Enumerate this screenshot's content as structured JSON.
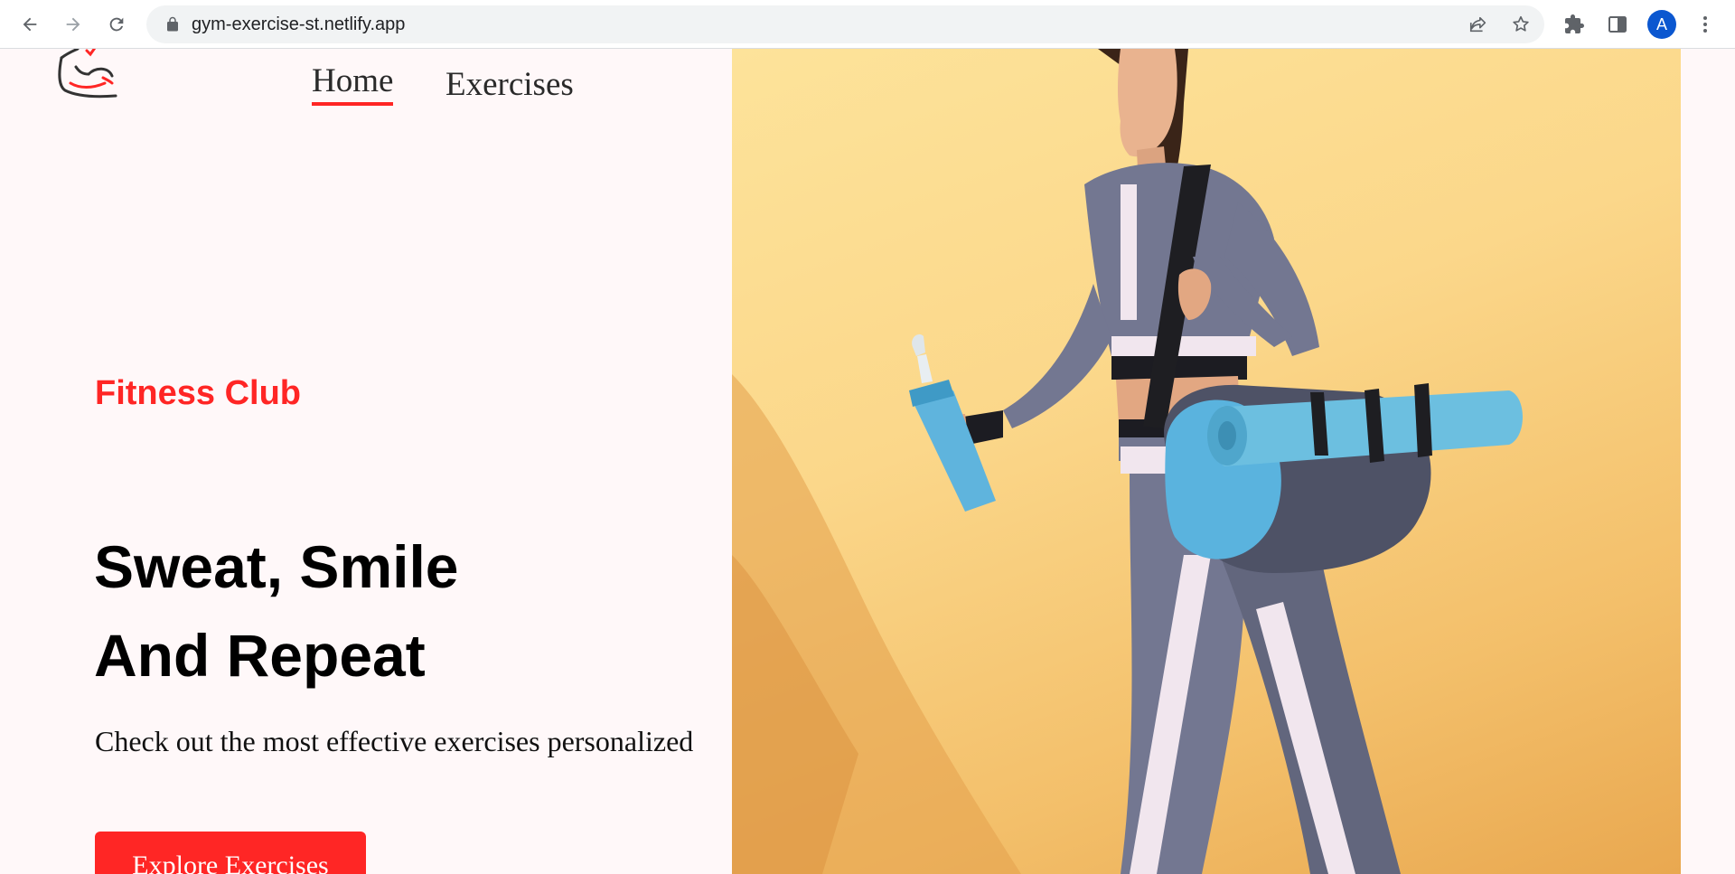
{
  "browser": {
    "url": "gym-exercise-st.netlify.app",
    "profile_initial": "A",
    "icons": [
      "back-arrow-icon",
      "forward-arrow-icon",
      "reload-icon",
      "lock-icon",
      "share-icon",
      "star-icon",
      "extensions-icon",
      "side-panel-icon",
      "menu-dots-icon"
    ]
  },
  "nav": {
    "home_label": "Home",
    "exercises_label": "Exercises",
    "logo_icon": "flexed-bicep-logo-icon"
  },
  "hero": {
    "subtitle": "Fitness Club",
    "title_line1": "Sweat, Smile",
    "title_line2": "And Repeat",
    "description": "Check out the most effective exercises personalized",
    "button_label": "Explore Exercises",
    "image": "woman-walking-with-gym-bag-and-bottle"
  },
  "colors": {
    "accent": "#ff2625",
    "page_background": "#fff8f9",
    "image_background": "#fbd78a"
  }
}
